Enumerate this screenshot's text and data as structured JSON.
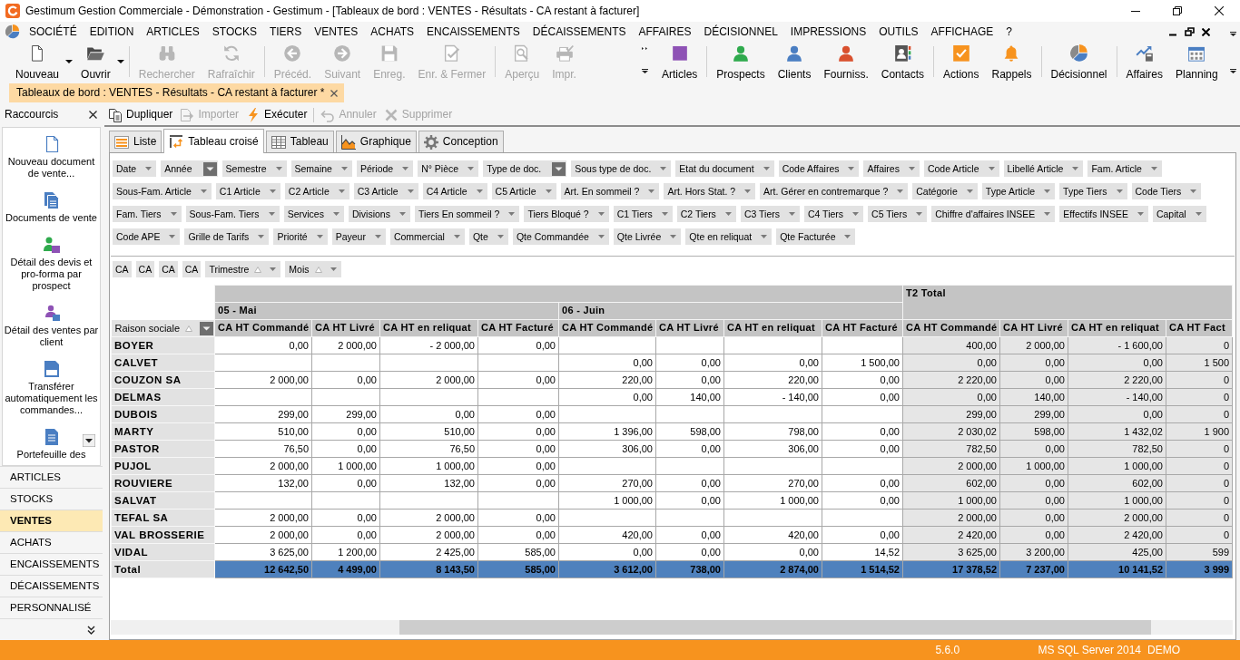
{
  "window": {
    "title": "Gestimum Gestion Commerciale - Démonstration - Gestimum - [Tableaux de bord : VENTES - Résultats - CA restant à facturer]"
  },
  "menu": [
    "SOCIÉTÉ",
    "EDITION",
    "ARTICLES",
    "STOCKS",
    "TIERS",
    "VENTES",
    "ACHATS",
    "ENCAISSEMENTS",
    "DÉCAISSEMENTS",
    "AFFAIRES",
    "DÉCISIONNEL",
    "IMPRESSIONS",
    "OUTILS",
    "AFFICHAGE",
    "?"
  ],
  "toolbar": [
    [
      {
        "label": "Nouveau",
        "dropdown": true,
        "disabled": false
      },
      {
        "label": "Ouvrir",
        "dropdown": true,
        "disabled": false
      }
    ],
    [
      {
        "label": "Rechercher",
        "dropdown": false,
        "disabled": true
      },
      {
        "label": "Rafraîchir",
        "dropdown": false,
        "disabled": true
      }
    ],
    [
      {
        "label": "Précéd.",
        "dropdown": false,
        "disabled": true
      },
      {
        "label": "Suivant",
        "dropdown": false,
        "disabled": true
      },
      {
        "label": "Enreg.",
        "dropdown": false,
        "disabled": true
      },
      {
        "label": "Enr. & Fermer",
        "dropdown": false,
        "disabled": true
      }
    ],
    [
      {
        "label": "Aperçu",
        "dropdown": false,
        "disabled": true
      },
      {
        "label": "Impr.",
        "dropdown": false,
        "disabled": true
      }
    ]
  ],
  "shortcut_toolbar": [
    [
      "Articles"
    ],
    [
      "Prospects",
      "Clients",
      "Fourniss.",
      "Contacts"
    ],
    [
      "Actions",
      "Rappels"
    ],
    [
      "Décisionnel"
    ],
    [
      "Affaires",
      "Planning"
    ]
  ],
  "document_tabs": [
    {
      "label": "Tableaux de bord : VENTES - Résultats - CA restant à facturer *",
      "selected": true
    }
  ],
  "shortcuts_panel": {
    "title": "Raccourcis",
    "items": [
      "Nouveau document de vente...",
      "Documents de vente",
      "Détail des devis et pro-forma par prospect",
      "Détail des ventes par client",
      "Transférer automatiquement les commandes...",
      "Portefeuille des"
    ],
    "sections": [
      {
        "label": "ARTICLES",
        "selected": false
      },
      {
        "label": "STOCKS",
        "selected": false
      },
      {
        "label": "VENTES",
        "selected": true
      },
      {
        "label": "ACHATS",
        "selected": false
      },
      {
        "label": "ENCAISSEMENTS",
        "selected": false
      },
      {
        "label": "DÉCAISSEMENTS",
        "selected": false
      },
      {
        "label": "PERSONNALISÉ",
        "selected": false
      }
    ]
  },
  "action_toolbar": [
    [
      {
        "label": "Dupliquer",
        "disabled": false
      },
      {
        "label": "Importer",
        "disabled": true
      },
      {
        "label": "Exécuter",
        "disabled": false
      }
    ],
    [
      {
        "label": "Annuler",
        "disabled": true
      },
      {
        "label": "Supprimer",
        "disabled": true
      }
    ]
  ],
  "view_tabs": [
    {
      "label": "Liste",
      "selected": false
    },
    {
      "label": "Tableau croisé",
      "selected": true
    },
    {
      "label": "Tableau",
      "selected": false
    },
    {
      "label": "Graphique",
      "selected": false
    },
    {
      "label": "Conception",
      "selected": false
    }
  ],
  "pivot": {
    "filter_fields": [
      {
        "label": "Date",
        "filtered": false
      },
      {
        "label": "Année",
        "filtered": true
      },
      {
        "label": "Semestre",
        "filtered": false
      },
      {
        "label": "Semaine",
        "filtered": false
      },
      {
        "label": "Période",
        "filtered": false
      },
      {
        "label": "N° Pièce",
        "filtered": false
      },
      {
        "label": "Type de doc.",
        "filtered": true
      },
      {
        "label": "Sous type de doc.",
        "filtered": false
      },
      {
        "label": "Etat du document",
        "filtered": false
      },
      {
        "label": "Code Affaires",
        "filtered": false
      },
      {
        "label": "Affaires",
        "filtered": false
      },
      {
        "label": "Code Article",
        "filtered": false
      },
      {
        "label": "Libellé Article",
        "filtered": false
      },
      {
        "label": "Fam. Article",
        "filtered": false
      },
      {
        "label": "Sous-Fam. Article",
        "filtered": false
      },
      {
        "label": "C1 Article",
        "filtered": false
      },
      {
        "label": "C2 Article",
        "filtered": false
      },
      {
        "label": "C3 Article",
        "filtered": false
      },
      {
        "label": "C4 Article",
        "filtered": false
      },
      {
        "label": "C5 Article",
        "filtered": false
      },
      {
        "label": "Art. En sommeil ?",
        "filtered": false
      },
      {
        "label": "Art. Hors Stat. ?",
        "filtered": false
      },
      {
        "label": "Art. Gérer en contremarque ?",
        "filtered": false
      },
      {
        "label": "Catégorie",
        "filtered": false
      },
      {
        "label": "Type Article",
        "filtered": false
      },
      {
        "label": "Type Tiers",
        "filtered": false
      },
      {
        "label": "Code Tiers",
        "filtered": false
      },
      {
        "label": "Fam. Tiers",
        "filtered": false
      },
      {
        "label": "Sous-Fam. Tiers",
        "filtered": false
      },
      {
        "label": "Services",
        "filtered": false
      },
      {
        "label": "Divisions",
        "filtered": false
      },
      {
        "label": "Tiers En sommeil ?",
        "filtered": false
      },
      {
        "label": "Tiers Bloqué ?",
        "filtered": false
      },
      {
        "label": "C1 Tiers",
        "filtered": false
      },
      {
        "label": "C2 Tiers",
        "filtered": false
      },
      {
        "label": "C3 Tiers",
        "filtered": false
      },
      {
        "label": "C4 Tiers",
        "filtered": false
      },
      {
        "label": "C5 Tiers",
        "filtered": false
      },
      {
        "label": "Chiffre d'affaires INSEE",
        "filtered": false
      },
      {
        "label": "Effectifs INSEE",
        "filtered": false
      },
      {
        "label": "Capital",
        "filtered": false
      },
      {
        "label": "Code APE",
        "filtered": false
      },
      {
        "label": "Grille de Tarifs",
        "filtered": false
      },
      {
        "label": "Priorité",
        "filtered": false
      },
      {
        "label": "Payeur",
        "filtered": false
      },
      {
        "label": "Commercial",
        "filtered": false
      },
      {
        "label": "Qte",
        "filtered": false
      },
      {
        "label": "Qte Commandée",
        "filtered": false
      },
      {
        "label": "Qte Livrée",
        "filtered": false
      },
      {
        "label": "Qte en reliquat",
        "filtered": false
      },
      {
        "label": "Qte Facturée",
        "filtered": false
      }
    ],
    "data_fields": [
      "CA",
      "CA",
      "CA",
      "CA"
    ],
    "column_fields": [
      {
        "label": "Trimestre",
        "sorted": true
      },
      {
        "label": "Mois",
        "sorted": true
      }
    ],
    "row_field": {
      "label": "Raison sociale",
      "sorted": true,
      "filtered": true
    },
    "column_groups": [
      {
        "label": "05 - Mai",
        "kind": "month",
        "measures": [
          "CA HT Commandé",
          "CA HT Livré",
          "CA HT en reliquat",
          "CA HT Facturé"
        ]
      },
      {
        "label": "06 - Juin",
        "kind": "month",
        "measures": [
          "CA HT Commandé",
          "CA HT Livré",
          "CA HT en reliquat",
          "CA HT Facturé"
        ]
      },
      {
        "label": "T2 Total",
        "kind": "total",
        "measures": [
          "CA HT Commandé",
          "CA HT Livré",
          "CA HT en reliquat",
          "CA HT Fact"
        ]
      }
    ],
    "rows": [
      {
        "label": "BOYER",
        "may": [
          "0,00",
          "2 000,00",
          "- 2 000,00",
          "0,00"
        ],
        "t2_total": [
          "400,00",
          "2 000,00",
          "- 1 600,00",
          "0"
        ]
      },
      {
        "label": "CALVET",
        "june": [
          "0,00",
          "0,00",
          "0,00",
          "1 500,00"
        ],
        "t2_total": [
          "0,00",
          "0,00",
          "0,00",
          "1 500"
        ]
      },
      {
        "label": "COUZON SA",
        "may": [
          "2 000,00",
          "0,00",
          "2 000,00",
          "0,00"
        ],
        "june": [
          "220,00",
          "0,00",
          "220,00",
          "0,00"
        ],
        "t2_total": [
          "2 220,00",
          "0,00",
          "2 220,00",
          "0"
        ]
      },
      {
        "label": "DELMAS",
        "june": [
          "0,00",
          "140,00",
          "- 140,00",
          "0,00"
        ],
        "t2_total": [
          "0,00",
          "140,00",
          "- 140,00",
          "0"
        ]
      },
      {
        "label": "DUBOIS",
        "may": [
          "299,00",
          "299,00",
          "0,00",
          "0,00"
        ],
        "t2_total": [
          "299,00",
          "299,00",
          "0,00",
          "0"
        ]
      },
      {
        "label": "MARTY",
        "may": [
          "510,00",
          "0,00",
          "510,00",
          "0,00"
        ],
        "june": [
          "1 396,00",
          "598,00",
          "798,00",
          "0,00"
        ],
        "t2_total": [
          "2 030,02",
          "598,00",
          "1 432,02",
          "1 900"
        ]
      },
      {
        "label": "PASTOR",
        "may": [
          "76,50",
          "0,00",
          "76,50",
          "0,00"
        ],
        "june": [
          "306,00",
          "0,00",
          "306,00",
          "0,00"
        ],
        "t2_total": [
          "782,50",
          "0,00",
          "782,50",
          "0"
        ]
      },
      {
        "label": "PUJOL",
        "may": [
          "2 000,00",
          "1 000,00",
          "1 000,00",
          "0,00"
        ],
        "t2_total": [
          "2 000,00",
          "1 000,00",
          "1 000,00",
          "0"
        ]
      },
      {
        "label": "ROUVIERE",
        "may": [
          "132,00",
          "0,00",
          "132,00",
          "0,00"
        ],
        "june": [
          "270,00",
          "0,00",
          "270,00",
          "0,00"
        ],
        "t2_total": [
          "602,00",
          "0,00",
          "602,00",
          "0"
        ]
      },
      {
        "label": "SALVAT",
        "june": [
          "1 000,00",
          "0,00",
          "1 000,00",
          "0,00"
        ],
        "t2_total": [
          "1 000,00",
          "0,00",
          "1 000,00",
          "0"
        ]
      },
      {
        "label": "TEFAL SA",
        "may": [
          "2 000,00",
          "0,00",
          "2 000,00",
          "0,00"
        ],
        "t2_total": [
          "2 000,00",
          "0,00",
          "2 000,00",
          "0"
        ]
      },
      {
        "label": "VAL BROSSERIE",
        "may": [
          "2 000,00",
          "0,00",
          "2 000,00",
          "0,00"
        ],
        "june": [
          "420,00",
          "0,00",
          "420,00",
          "0,00"
        ],
        "t2_total": [
          "2 420,00",
          "0,00",
          "2 420,00",
          "0"
        ]
      },
      {
        "label": "VIDAL",
        "may": [
          "3 625,00",
          "1 200,00",
          "2 425,00",
          "585,00"
        ],
        "june": [
          "0,00",
          "0,00",
          "0,00",
          "14,52"
        ],
        "t2_total": [
          "3 625,00",
          "3 200,00",
          "425,00",
          "599"
        ]
      }
    ],
    "total": {
      "label": "Total",
      "may": [
        "12 642,50",
        "4 499,00",
        "8 143,50",
        "585,00"
      ],
      "june": [
        "3 612,00",
        "738,00",
        "2 874,00",
        "1 514,52"
      ],
      "t2_total": [
        "17 378,52",
        "7 237,00",
        "10 141,52",
        "3 999"
      ]
    }
  },
  "status_bar": [
    "5.6.0",
    "MS SQL Server 2014",
    "DEMO"
  ]
}
